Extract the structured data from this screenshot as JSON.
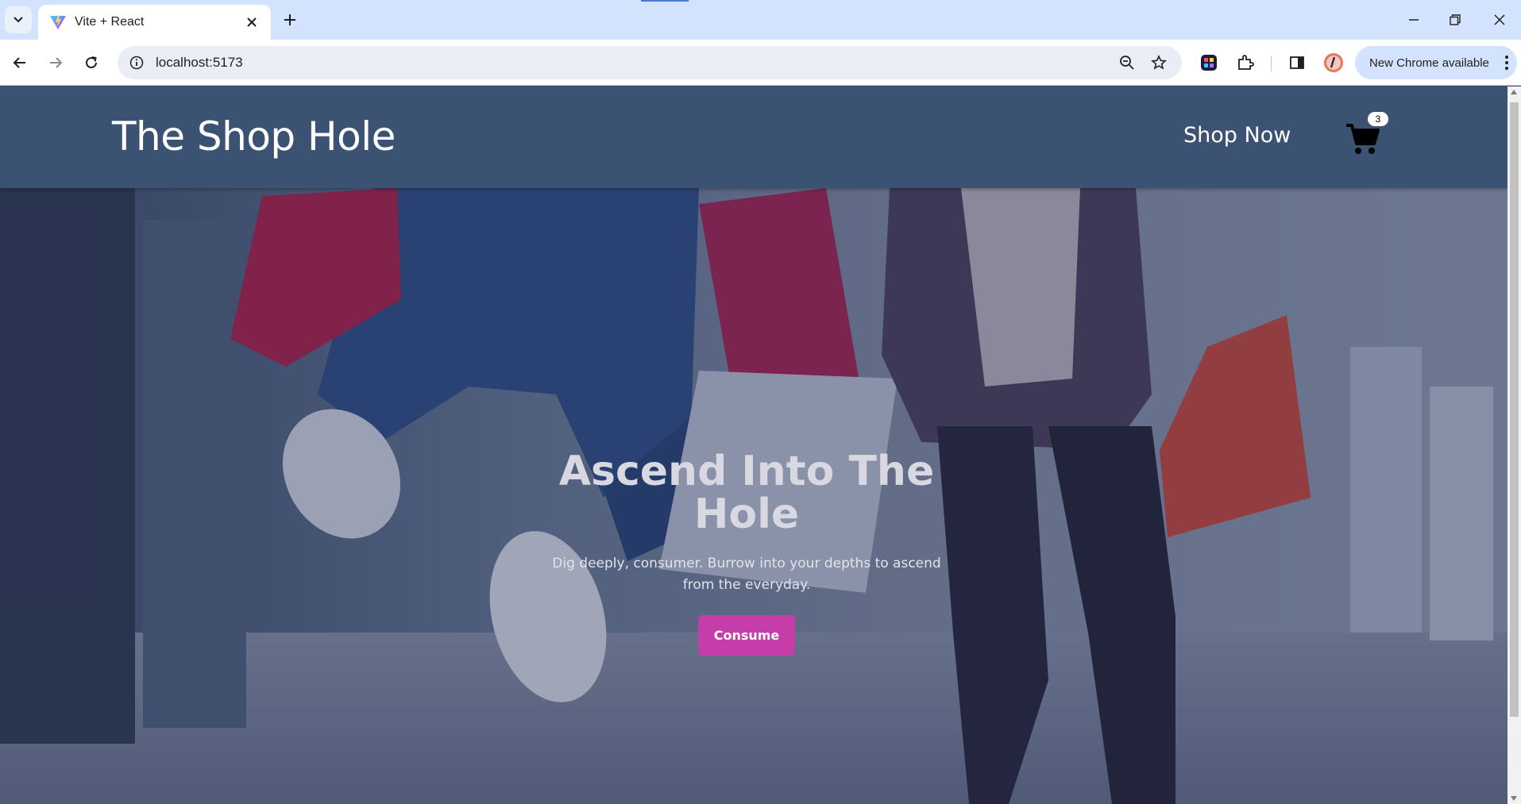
{
  "browser": {
    "tab_title": "Vite + React",
    "url": "localhost:5173",
    "update_label": "New Chrome available"
  },
  "site": {
    "brand": "The Shop Hole",
    "nav_shop": "Shop Now",
    "cart_count": "3"
  },
  "hero": {
    "title": "Ascend Into The Hole",
    "subtitle": "Dig deeply, consumer. Burrow into your depths to ascend from the everyday.",
    "cta": "Consume"
  },
  "colors": {
    "header_bg": "#3b5273",
    "cta_bg": "#c53da8",
    "browser_frame": "#d3e3fd"
  }
}
